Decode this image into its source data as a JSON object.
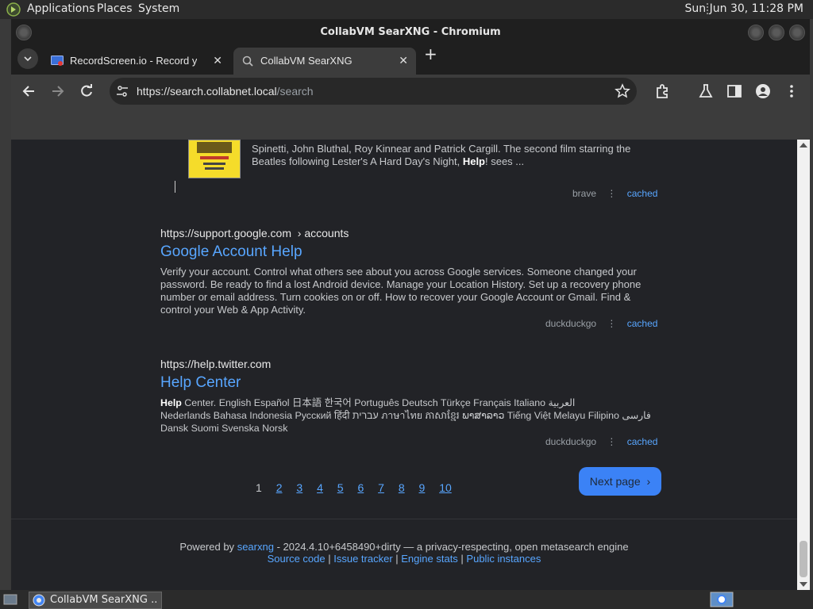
{
  "panel": {
    "applications": "Applications",
    "places": "Places",
    "system": "System",
    "clock": "Sun Jun 30, 11:28 PM"
  },
  "window": {
    "title": "CollabVM SearXNG - Chromium"
  },
  "tabs": [
    {
      "label": "RecordScreen.io - Record your screen",
      "active": false
    },
    {
      "label": "CollabVM SearXNG",
      "active": true
    }
  ],
  "omnibox": {
    "scheme_host": "https://search.collabnet.local",
    "path": "/search"
  },
  "results": [
    {
      "snippet_plain_a": "Spinetti, John Bluthal, Roy Kinnear and Patrick Cargill. The second film starring the",
      "snippet_plain_b": "Beatles following Lester's A Hard Day's Night, ",
      "snippet_bold": "Help",
      "snippet_plain_c": "! sees ...",
      "engine": "brave",
      "cached": "cached"
    },
    {
      "url": "https://support.google.com",
      "crumb": "› accounts",
      "title": "Google Account Help",
      "content": "Verify your account. Control what others see about you across Google services. Set up a recovery phone",
      "content_line1": "Verify your account. Control what others see about you across Google services. Someone changed your",
      "content_line2": "password. Be ready to find a lost Android device. Manage your Location History. Set up a recovery phone",
      "content_line3": "number or email address. Turn cookies on or off. How to recover your Google Account or Gmail. Find &",
      "content_line4": "control your Web & App Activity.",
      "engine": "duckduckgo",
      "cached": "cached"
    },
    {
      "url": "https://help.twitter.com",
      "title": "Help Center",
      "content_bold": "Help",
      "content_line1": " Center. English Español 日本語 한국어 Português Deutsch Türkçe Français Italiano العربية",
      "content_line2": "Nederlands Bahasa Indonesia Русский हिंदी עברית ภาษาไทย ភាសាខ្មែរ ພາສາລາວ Tiếng Việt Melayu Filipino فارسی",
      "content_line3": "Dansk Suomi Svenska Norsk",
      "engine": "duckduckgo",
      "cached": "cached"
    }
  ],
  "pager": {
    "current": "1",
    "pages": [
      "2",
      "3",
      "4",
      "5",
      "6",
      "7",
      "8",
      "9",
      "10"
    ],
    "next_label": "Next page"
  },
  "footer": {
    "powered_by": "Powered by",
    "searxng": "searxng",
    "version_text": "- 2024.4.10+6458490+dirty — a privacy-respecting, open metasearch engine",
    "links": [
      "Source code",
      "Issue tracker",
      "Engine stats",
      "Public instances"
    ]
  },
  "taskbar": {
    "task_label": "CollabVM SearXNG ..."
  },
  "colors": {
    "link": "#58a6ff",
    "page_bg": "#222327",
    "next_button": "#3b82f6"
  }
}
